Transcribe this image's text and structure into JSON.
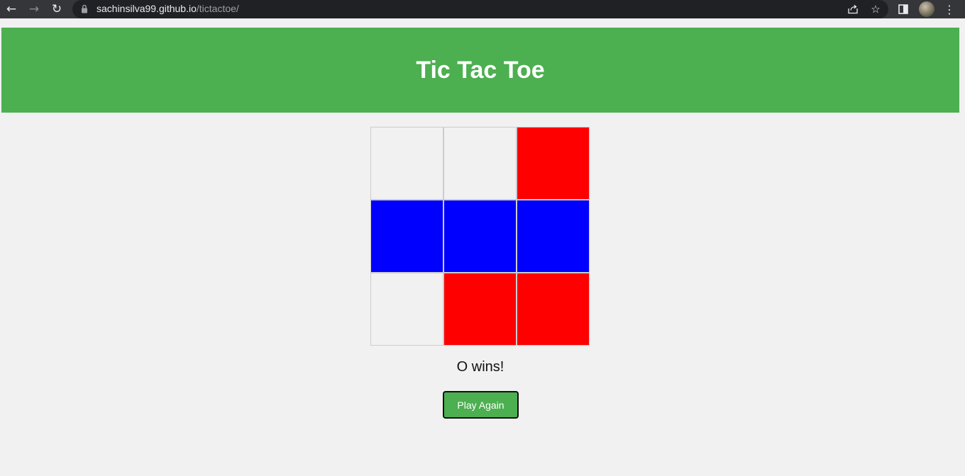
{
  "browser": {
    "url_host": "sachinsilva99.github.io",
    "url_path": "/tictactoe/"
  },
  "page": {
    "title": "Tic Tac Toe",
    "message": "O wins!",
    "play_again_label": "Play Again"
  },
  "colors": {
    "header": "#4caf50",
    "button": "#4caf50",
    "x_cell": "#ff0000",
    "o_cell": "#0000ff",
    "empty_cell": "#f1f1f1"
  },
  "board": [
    [
      "",
      "",
      "X"
    ],
    [
      "O",
      "O",
      "O"
    ],
    [
      "",
      "X",
      "X"
    ]
  ]
}
